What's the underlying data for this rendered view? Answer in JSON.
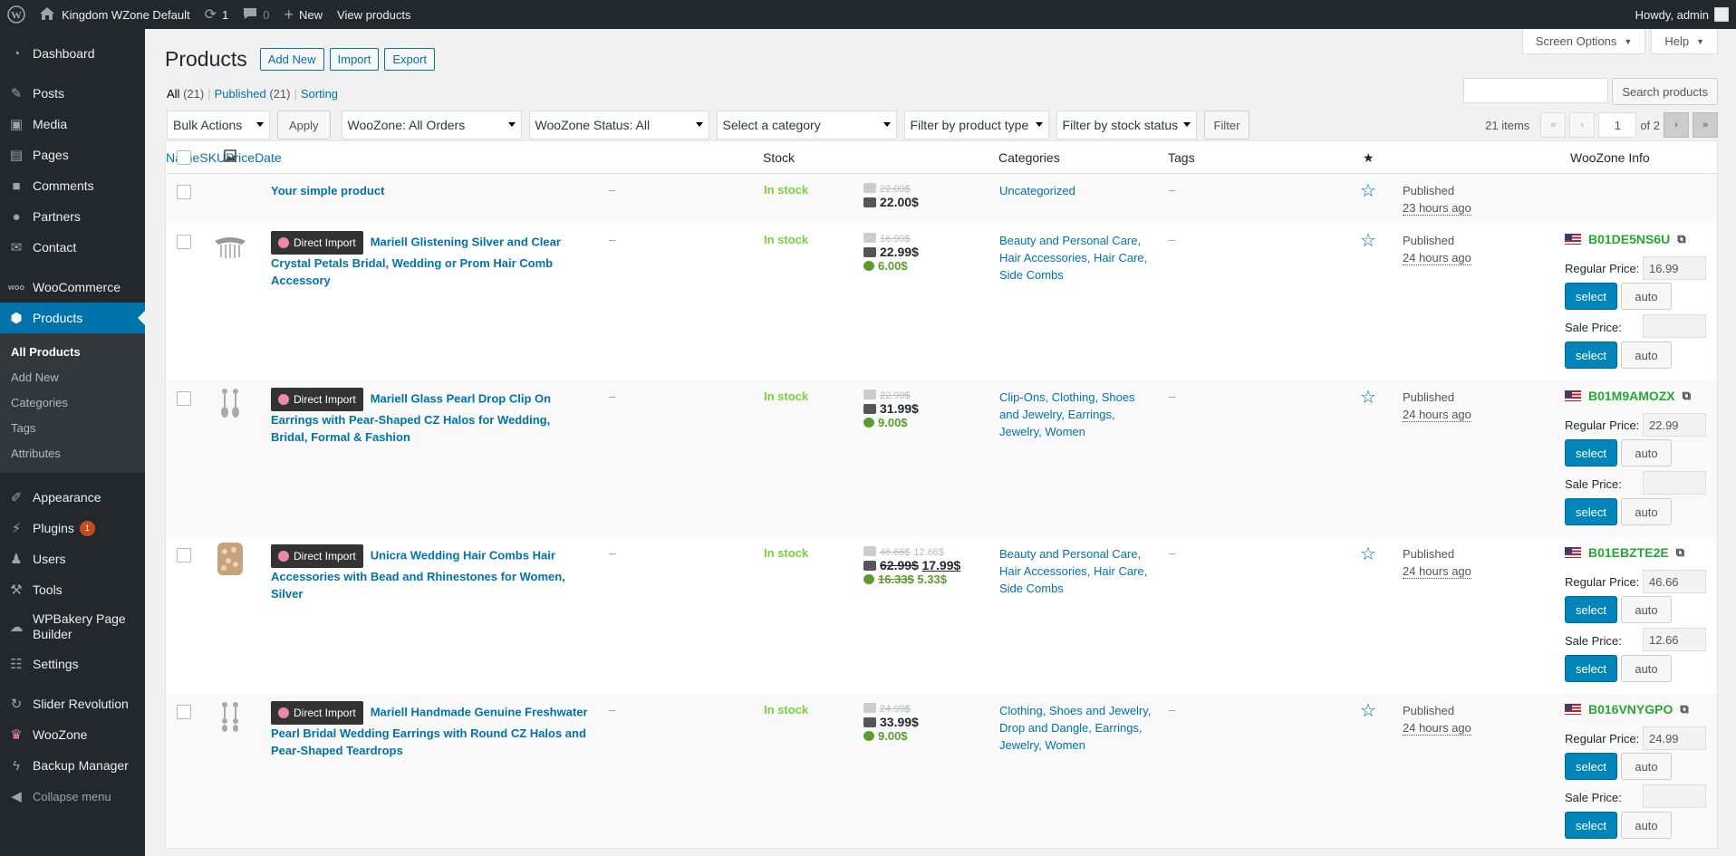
{
  "adminbar": {
    "site_name": "Kingdom WZone Default",
    "updates_count": "1",
    "comments_count": "0",
    "new_label": "New",
    "view_label": "View products",
    "howdy": "Howdy, admin"
  },
  "sidebar": {
    "items": [
      {
        "label": "Dashboard",
        "icon": "dashboard-icon"
      },
      {
        "label": "Posts",
        "icon": "pin-icon"
      },
      {
        "label": "Media",
        "icon": "media-icon"
      },
      {
        "label": "Pages",
        "icon": "pages-icon"
      },
      {
        "label": "Comments",
        "icon": "comments-icon"
      },
      {
        "label": "Partners",
        "icon": "partners-icon"
      },
      {
        "label": "Contact",
        "icon": "mail-icon"
      },
      {
        "label": "WooCommerce",
        "icon": "woo-icon"
      },
      {
        "label": "Products",
        "icon": "products-icon"
      },
      {
        "label": "Appearance",
        "icon": "brush-icon"
      },
      {
        "label": "Plugins",
        "icon": "plugin-icon",
        "badge": "1"
      },
      {
        "label": "Users",
        "icon": "users-icon"
      },
      {
        "label": "Tools",
        "icon": "wrench-icon"
      },
      {
        "label": "WPBakery Page Builder",
        "icon": "bakery-icon"
      },
      {
        "label": "Settings",
        "icon": "settings-icon"
      },
      {
        "label": "Slider Revolution",
        "icon": "refresh-icon"
      },
      {
        "label": "WooZone",
        "icon": "woozone-icon"
      },
      {
        "label": "Backup Manager",
        "icon": "bolt-icon"
      },
      {
        "label": "Collapse menu",
        "icon": "collapse-icon"
      }
    ],
    "submenu": [
      "All Products",
      "Add New",
      "Categories",
      "Tags",
      "Attributes"
    ]
  },
  "screen_meta": {
    "options": "Screen Options",
    "help": "Help"
  },
  "header": {
    "title": "Products",
    "actions": [
      "Add New",
      "Import",
      "Export"
    ]
  },
  "views": {
    "all": "All",
    "all_count": "(21)",
    "published": "Published",
    "published_count": "(21)",
    "sorting": "Sorting"
  },
  "search": {
    "button": "Search products",
    "value": ""
  },
  "filters": {
    "bulk": "Bulk Actions",
    "apply": "Apply",
    "woo_orders": "WooZone: All Orders",
    "woo_status": "WooZone Status: All",
    "category": "Select a category",
    "type": "Filter by product type",
    "stock": "Filter by stock status",
    "filter": "Filter"
  },
  "pagination": {
    "items": "21 items",
    "current": "1",
    "of": "of 2"
  },
  "columns": {
    "name": "Name",
    "sku": "SKU",
    "stock": "Stock",
    "price": "Price",
    "categories": "Categories",
    "tags": "Tags",
    "date": "Date",
    "woozone": "WooZone Info"
  },
  "woozone_labels": {
    "regular": "Regular Price:",
    "sale": "Sale Price:",
    "select": "select",
    "auto": "auto",
    "direct_import": "Direct Import"
  },
  "rows": [
    {
      "name": "Your simple product",
      "sku": "–",
      "stock": "In stock",
      "price_old": "22.00$",
      "price_main": "22.00$",
      "categories": "Uncategorized",
      "tags": "–",
      "status": "Published",
      "date": "23 hours ago"
    },
    {
      "name": "Mariell Glistening Silver and Clear Crystal Petals Bridal, Wedding or Prom Hair Comb Accessory",
      "sku": "–",
      "stock": "In stock",
      "price_old": "16.99$",
      "price_main": "22.99$",
      "price_green": "6.00$",
      "categories": "Beauty and Personal Care, Hair Accessories, Hair Care, Side Combs",
      "tags": "–",
      "status": "Published",
      "date": "24 hours ago",
      "asin": "B01DE5NS6U",
      "regular": "16.99",
      "sale": ""
    },
    {
      "name": "Mariell Glass Pearl Drop Clip On Earrings with Pear-Shaped CZ Halos for Wedding, Bridal, Formal & Fashion",
      "sku": "–",
      "stock": "In stock",
      "price_old": "22.99$",
      "price_main": "31.99$",
      "price_green": "9.00$",
      "categories": "Clip-Ons, Clothing, Shoes and Jewelry, Earrings, Jewelry, Women",
      "tags": "–",
      "status": "Published",
      "date": "24 hours ago",
      "asin": "B01M9AMOZX",
      "regular": "22.99",
      "sale": ""
    },
    {
      "name": "Unicra Wedding Hair Combs Hair Accessories with Bead and Rhinestones for Women, Silver",
      "sku": "–",
      "stock": "In stock",
      "price_old": "46.66$",
      "price_old2": "12.66$",
      "price_main": "62.99$",
      "price_main2": "17.99$",
      "price_green": "16.33$",
      "price_green2": "5.33$",
      "categories": "Beauty and Personal Care, Hair Accessories, Hair Care, Side Combs",
      "tags": "–",
      "status": "Published",
      "date": "24 hours ago",
      "asin": "B01EBZTE2E",
      "regular": "46.66",
      "sale": "12.66"
    },
    {
      "name": "Mariell Handmade Genuine Freshwater Pearl Bridal Wedding Earrings with Round CZ Halos and Pear-Shaped Teardrops",
      "sku": "–",
      "stock": "In stock",
      "price_old": "24.99$",
      "price_main": "33.99$",
      "price_green": "9.00$",
      "categories": "Clothing, Shoes and Jewelry, Drop and Dangle, Earrings, Jewelry, Women",
      "tags": "–",
      "status": "Published",
      "date": "24 hours ago",
      "asin": "B016VNYGPO",
      "regular": "24.99",
      "sale": ""
    }
  ]
}
